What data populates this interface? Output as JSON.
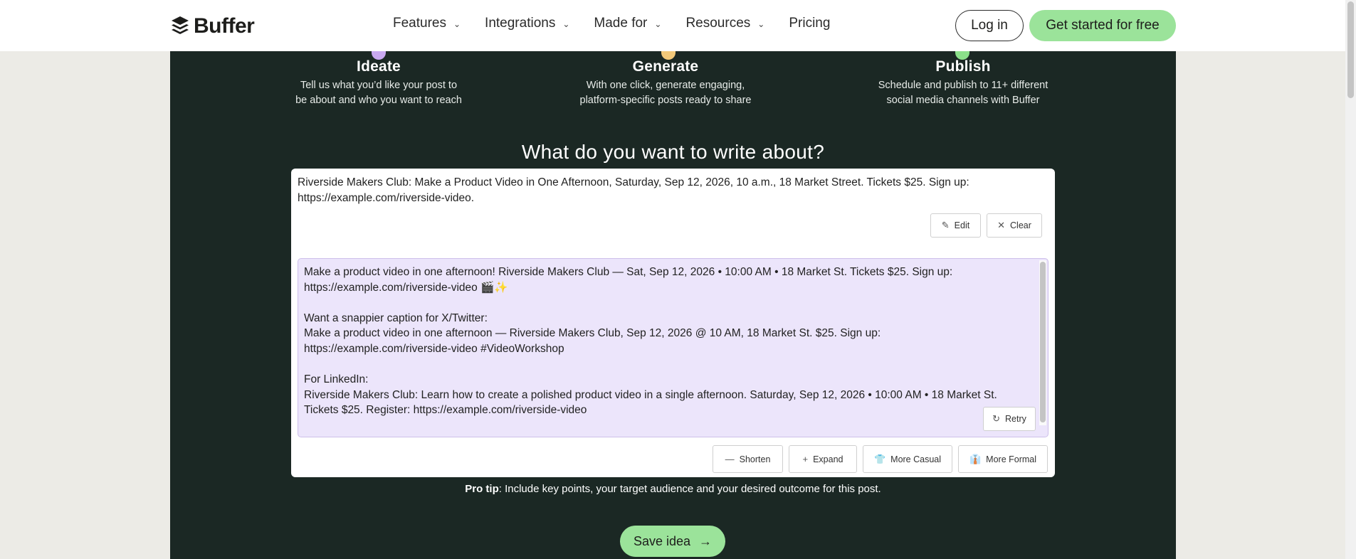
{
  "nav": {
    "brand": "Buffer",
    "menu": [
      {
        "label": "Features",
        "has_dropdown": true
      },
      {
        "label": "Integrations",
        "has_dropdown": true
      },
      {
        "label": "Made for",
        "has_dropdown": true
      },
      {
        "label": "Resources",
        "has_dropdown": true
      },
      {
        "label": "Pricing",
        "has_dropdown": false
      }
    ],
    "login_label": "Log in",
    "cta_label": "Get started for free"
  },
  "steps": [
    {
      "title": "Ideate",
      "desc1": "Tell us what you’d like your post to",
      "desc2": "be about and who you want to reach",
      "color": "#c9a8f0"
    },
    {
      "title": "Generate",
      "desc1": "With one click, generate engaging,",
      "desc2": "platform-specific posts ready to share",
      "color": "#f3c97a"
    },
    {
      "title": "Publish",
      "desc1": "Schedule and publish to 11+ different",
      "desc2": "social media channels with Buffer",
      "color": "#8be08a"
    }
  ],
  "heading": "What do you want to write about?",
  "prompt": "Riverside Makers Club: Make a Product Video in One Afternoon, Saturday, Sep 12, 2026, 10 a.m., 18 Market Street. Tickets $25. Sign up: https://example.com/riverside-video.",
  "prompt_actions": {
    "edit": "Edit",
    "clear": "Clear"
  },
  "output_lines": [
    "Make a product video in one afternoon! Riverside Makers Club — Sat, Sep 12, 2026 • 10:00 AM • 18 Market St. Tickets $25. Sign up:",
    "https://example.com/riverside-video 🎬✨",
    "",
    "Want a snappier caption for X/Twitter:",
    "Make a product video in one afternoon — Riverside Makers Club, Sep 12, 2026 @ 10 AM, 18 Market St. $25. Sign up:",
    "https://example.com/riverside-video #VideoWorkshop",
    "",
    "For LinkedIn:",
    "Riverside Makers Club: Learn how to create a polished product video in a single afternoon. Saturday, Sep 12, 2026 • 10:00 AM • 18 Market St.",
    "Tickets $25. Register: https://example.com/riverside-video"
  ],
  "retry_label": "Retry",
  "tone_actions": {
    "shorten": "Shorten",
    "expand": "Expand",
    "casual": "More Casual",
    "formal": "More Formal"
  },
  "tip": {
    "bold": "Pro tip",
    "text": ": Include key points, your target audience and your desired outcome for this post."
  },
  "save_label": "Save idea",
  "colors": {
    "panel": "#1b2824",
    "accent_green": "#9be39a",
    "output_bg": "#ece5fb"
  }
}
